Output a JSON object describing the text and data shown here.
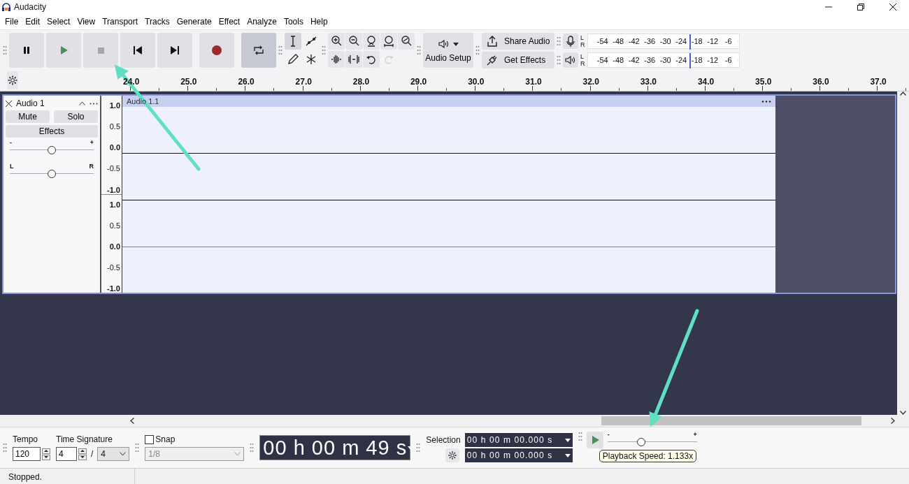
{
  "window": {
    "title": "Audacity"
  },
  "menu": [
    "File",
    "Edit",
    "Select",
    "View",
    "Transport",
    "Tracks",
    "Generate",
    "Effect",
    "Analyze",
    "Tools",
    "Help"
  ],
  "transport": [
    {
      "kind": "pause",
      "pressed": false
    },
    {
      "kind": "play",
      "pressed": false
    },
    {
      "kind": "stop",
      "pressed": false
    },
    {
      "kind": "skip-start",
      "pressed": false
    },
    {
      "kind": "skip-end",
      "pressed": false
    },
    {
      "kind": "record",
      "pressed": false
    },
    {
      "kind": "loop",
      "pressed": true
    }
  ],
  "tools": [
    {
      "kind": "select",
      "selected": true
    },
    {
      "kind": "envelope",
      "selected": false
    },
    {
      "kind": "draw",
      "selected": false
    },
    {
      "kind": "multi",
      "selected": false
    }
  ],
  "edit_tools": [
    {
      "kind": "zoom-in",
      "disabled": false
    },
    {
      "kind": "zoom-out",
      "disabled": false
    },
    {
      "kind": "fit-selection",
      "disabled": false
    },
    {
      "kind": "fit-project",
      "disabled": false
    },
    {
      "kind": "zoom-toggle",
      "disabled": false
    },
    {
      "kind": "trim",
      "disabled": false
    },
    {
      "kind": "silence",
      "disabled": false
    },
    {
      "kind": "undo",
      "disabled": false
    },
    {
      "kind": "redo",
      "disabled": true
    }
  ],
  "audio_setup": {
    "label": "Audio Setup"
  },
  "share_audio": {
    "label": "Share Audio"
  },
  "get_effects": {
    "label": "Get Effects"
  },
  "meters": [
    {
      "kind": "record",
      "channels": [
        "L",
        "R"
      ],
      "ticks": [
        "-54",
        "-48",
        "-42",
        "-36",
        "-30",
        "-24",
        "-18",
        "-12",
        "-6"
      ]
    },
    {
      "kind": "playback",
      "channels": [
        "L",
        "R"
      ],
      "ticks": [
        "-54",
        "-48",
        "-42",
        "-36",
        "-30",
        "-24",
        "-18",
        "-12",
        "-6"
      ]
    }
  ],
  "ruler": [
    "24.0",
    "25.0",
    "26.0",
    "27.0",
    "28.0",
    "29.0",
    "30.0",
    "31.0",
    "32.0",
    "33.0",
    "34.0",
    "35.0",
    "36.0",
    "37.0"
  ],
  "track": {
    "name": "Audio 1",
    "mute": "Mute",
    "solo": "Solo",
    "effects": "Effects",
    "gain": {
      "min": "-",
      "max": "+",
      "level": 0.5
    },
    "pan": {
      "min": "L",
      "max": "R",
      "level": 0.5
    },
    "clip": "Audio 1.1",
    "channels": [
      {
        "scale": [
          "1.0",
          "0.5",
          "0.0",
          "-0.5",
          "-1.0"
        ]
      },
      {
        "scale": [
          "1.0",
          "0.5",
          "0.0",
          "-0.5",
          "-1.0"
        ]
      }
    ]
  },
  "bottom": {
    "tempo": {
      "label": "Tempo",
      "value": "120"
    },
    "time_signature": {
      "label": "Time Signature",
      "upper": "4",
      "separator": "/",
      "lower": "4"
    },
    "snap": {
      "label": "Snap",
      "checked": false,
      "value": "1/8"
    },
    "time": "00 h 00 m 49 s",
    "selection": {
      "label": "Selection",
      "start": "00 h 00 m 00.000 s",
      "end": "00 h 00 m 00.000 s"
    },
    "play_at_speed": {
      "min": "-",
      "max": "+",
      "level": 0.375,
      "tooltip": "Playback Speed: 1.133x"
    }
  },
  "status_bar": {
    "text": "Stopped."
  }
}
